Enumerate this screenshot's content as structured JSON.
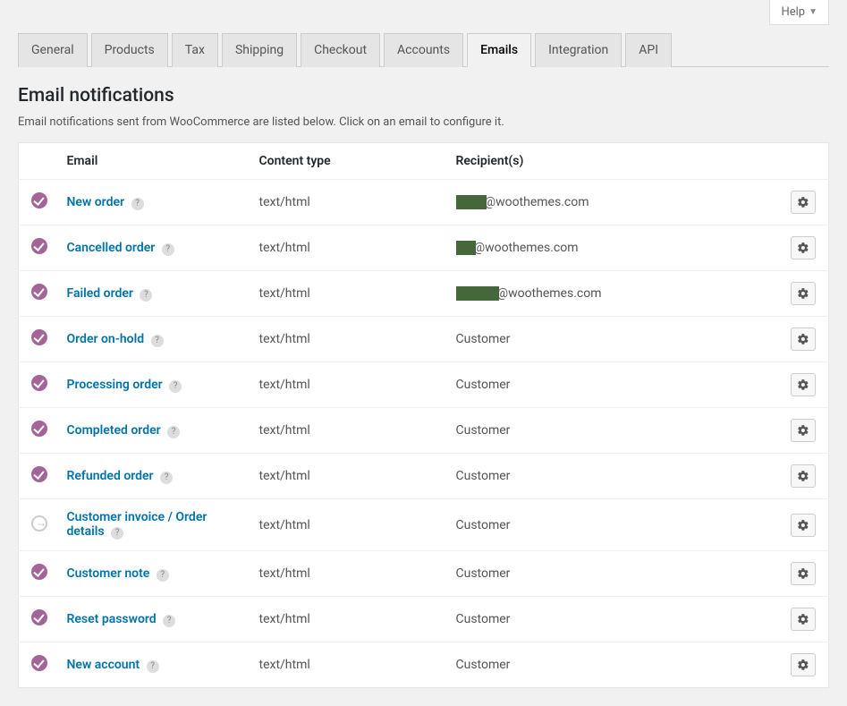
{
  "help_label": "Help",
  "tabs": [
    {
      "label": "General",
      "active": false
    },
    {
      "label": "Products",
      "active": false
    },
    {
      "label": "Tax",
      "active": false
    },
    {
      "label": "Shipping",
      "active": false
    },
    {
      "label": "Checkout",
      "active": false
    },
    {
      "label": "Accounts",
      "active": false
    },
    {
      "label": "Emails",
      "active": true
    },
    {
      "label": "Integration",
      "active": false
    },
    {
      "label": "API",
      "active": false
    }
  ],
  "section": {
    "title": "Email notifications",
    "description": "Email notifications sent from WooCommerce are listed below. Click on an email to configure it."
  },
  "columns": {
    "email": "Email",
    "content_type": "Content type",
    "recipients": "Recipient(s)"
  },
  "rows": [
    {
      "status": "enabled",
      "name": "New order",
      "content_type": "text/html",
      "recipient_redacted": true,
      "recipient_domain": "@woothemes.com",
      "redact_width": 34
    },
    {
      "status": "enabled",
      "name": "Cancelled order",
      "content_type": "text/html",
      "recipient_redacted": true,
      "recipient_domain": "@woothemes.com",
      "redact_width": 22
    },
    {
      "status": "enabled",
      "name": "Failed order",
      "content_type": "text/html",
      "recipient_redacted": true,
      "recipient_domain": "@woothemes.com",
      "redact_width": 48
    },
    {
      "status": "enabled",
      "name": "Order on-hold",
      "content_type": "text/html",
      "recipient": "Customer"
    },
    {
      "status": "enabled",
      "name": "Processing order",
      "content_type": "text/html",
      "recipient": "Customer"
    },
    {
      "status": "enabled",
      "name": "Completed order",
      "content_type": "text/html",
      "recipient": "Customer"
    },
    {
      "status": "enabled",
      "name": "Refunded order",
      "content_type": "text/html",
      "recipient": "Customer"
    },
    {
      "status": "manual",
      "name": "Customer invoice / Order details",
      "content_type": "text/html",
      "recipient": "Customer"
    },
    {
      "status": "enabled",
      "name": "Customer note",
      "content_type": "text/html",
      "recipient": "Customer"
    },
    {
      "status": "enabled",
      "name": "Reset password",
      "content_type": "text/html",
      "recipient": "Customer"
    },
    {
      "status": "enabled",
      "name": "New account",
      "content_type": "text/html",
      "recipient": "Customer"
    }
  ]
}
